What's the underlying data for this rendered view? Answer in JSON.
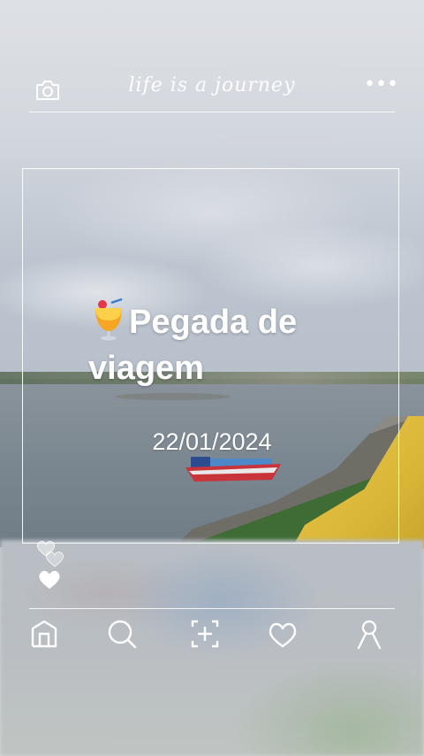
{
  "header": {
    "title": "life is a journey",
    "camera_icon": "camera-icon",
    "more_icon": "more-dots-icon",
    "more_label": "•••"
  },
  "post": {
    "emoji": "🍹",
    "title": "Pegada de viagem",
    "date": "22/01/2024"
  },
  "reactions": {
    "icons": [
      "heart-outline-icon",
      "heart-outline-icon",
      "heart-filled-icon"
    ]
  },
  "nav": {
    "items": [
      {
        "name": "home",
        "icon": "home-icon"
      },
      {
        "name": "search",
        "icon": "search-icon"
      },
      {
        "name": "add",
        "icon": "add-post-icon"
      },
      {
        "name": "likes",
        "icon": "heart-icon"
      },
      {
        "name": "profile",
        "icon": "profile-icon"
      }
    ]
  },
  "colors": {
    "ui_white": "#ffffff",
    "railing_yellow": "#e0bc3e",
    "water": "#7b8790"
  }
}
